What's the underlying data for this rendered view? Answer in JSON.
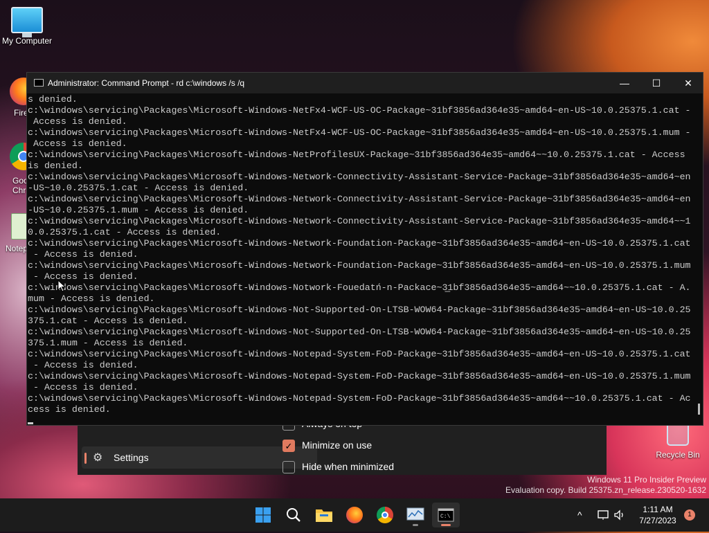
{
  "desktop": {
    "icons": [
      {
        "label": "My Computer"
      },
      {
        "label": "Fire"
      },
      {
        "label": "Goo\nChr"
      },
      {
        "label": "Notep"
      }
    ],
    "recycle_bin": "Recycle Bin",
    "watermark": {
      "line1": "Windows 11 Pro Insider Preview",
      "line2": "Evaluation copy. Build 25375.zn_release.230520-1632"
    }
  },
  "settings_dialog": {
    "nav_item": "Settings",
    "options": [
      {
        "label": "Always on top",
        "checked": false
      },
      {
        "label": "Minimize on use",
        "checked": true
      },
      {
        "label": "Hide when minimized",
        "checked": false
      }
    ]
  },
  "cmd_window": {
    "title": "Administrator:  Command Prompt - rd  c:\\windows /s /q",
    "buttons": {
      "minimize": "—",
      "maximize": "☐",
      "close": "✕"
    },
    "lines": [
      "s denied.",
      "c:\\windows\\servicing\\Packages\\Microsoft-Windows-NetFx4-WCF-US-OC-Package~31bf3856ad364e35~amd64~en-US~10.0.25375.1.cat -",
      " Access is denied.",
      "c:\\windows\\servicing\\Packages\\Microsoft-Windows-NetFx4-WCF-US-OC-Package~31bf3856ad364e35~amd64~en-US~10.0.25375.1.mum -",
      " Access is denied.",
      "c:\\windows\\servicing\\Packages\\Microsoft-Windows-NetProfilesUX-Package~31bf3856ad364e35~amd64~~10.0.25375.1.cat - Access",
      "is denied.",
      "c:\\windows\\servicing\\Packages\\Microsoft-Windows-Network-Connectivity-Assistant-Service-Package~31bf3856ad364e35~amd64~en",
      "-US~10.0.25375.1.cat - Access is denied.",
      "c:\\windows\\servicing\\Packages\\Microsoft-Windows-Network-Connectivity-Assistant-Service-Package~31bf3856ad364e35~amd64~en",
      "-US~10.0.25375.1.mum - Access is denied.",
      "c:\\windows\\servicing\\Packages\\Microsoft-Windows-Network-Connectivity-Assistant-Service-Package~31bf3856ad364e35~amd64~~1",
      "0.0.25375.1.cat - Access is denied.",
      "c:\\windows\\servicing\\Packages\\Microsoft-Windows-Network-Foundation-Package~31bf3856ad364e35~amd64~en-US~10.0.25375.1.cat",
      " - Access is denied.",
      "c:\\windows\\servicing\\Packages\\Microsoft-Windows-Network-Foundation-Package~31bf3856ad364e35~amd64~en-US~10.0.25375.1.mum",
      " - Access is denied.",
      "c:\\windows\\servicing\\Packages\\Microsoft-Windows-Notwork-Fouedatń-n-Packace~3̲1bf3856ad364e35~amd64~~10.0.25375.1.cat - A.",
      "mum - Access is denied.",
      "c:\\windows\\servicing\\Packages\\Microsoft-Windows-Not-Supported-On-LTSB-WOW64-Package~31bf3856ad364e35~amd64~en-US~10.0.25",
      "375.1.cat - Access is denied.",
      "c:\\windows\\servicing\\Packages\\Microsoft-Windows-Not-Supported-On-LTSB-WOW64-Package~31bf3856ad364e35~amd64~en-US~10.0.25",
      "375.1.mum - Access is denied.",
      "c:\\windows\\servicing\\Packages\\Microsoft-Windows-Notepad-System-FoD-Package~31bf3856ad364e35~amd64~en-US~10.0.25375.1.cat",
      " - Access is denied.",
      "c:\\windows\\servicing\\Packages\\Microsoft-Windows-Notepad-System-FoD-Package~31bf3856ad364e35~amd64~en-US~10.0.25375.1.mum",
      " - Access is denied.",
      "c:\\windows\\servicing\\Packages\\Microsoft-Windows-Notepad-System-FoD-Package~31bf3856ad364e35~amd64~~10.0.25375.1.cat - Ac",
      "cess is denied."
    ]
  },
  "taskbar": {
    "apps": [
      {
        "name": "start",
        "icon": "windows-logo-icon",
        "active": false
      },
      {
        "name": "search",
        "icon": "search-icon",
        "active": false
      },
      {
        "name": "file-explorer",
        "icon": "folder-icon",
        "active": false
      },
      {
        "name": "firefox",
        "icon": "firefox-icon",
        "active": false
      },
      {
        "name": "chrome",
        "icon": "chrome-icon",
        "active": false
      },
      {
        "name": "resource-monitor",
        "icon": "monitor-chart-icon",
        "active": false
      },
      {
        "name": "command-prompt",
        "icon": "terminal-icon",
        "active": true
      }
    ],
    "tray": {
      "chevron": "^",
      "time": "1:11 AM",
      "date": "7/27/2023",
      "notifications": "1"
    }
  },
  "colors": {
    "accent": "#e9826a",
    "console_bg": "#0c0c0c",
    "console_fg": "#cccccc",
    "taskbar_bg": "#1c1c1c"
  }
}
